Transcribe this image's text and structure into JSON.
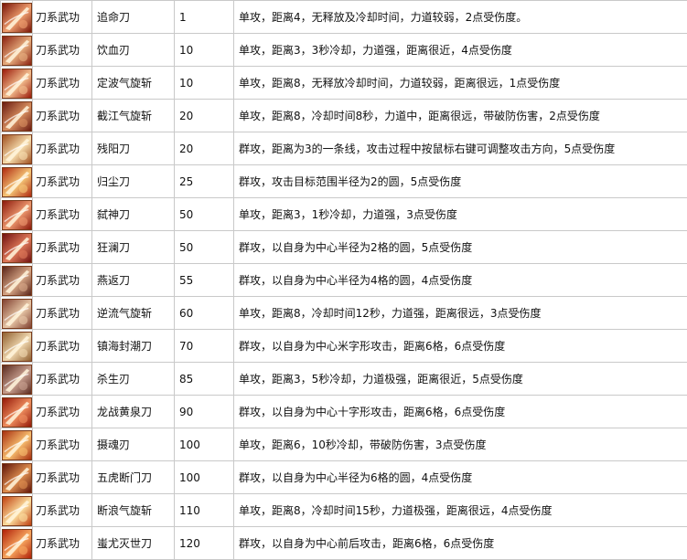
{
  "rows": [
    {
      "icon": "blade-slash-icon",
      "category": "刀系武功",
      "name": "追命刀",
      "level": "1",
      "desc": "单攻，距离4，无释放及冷却时间，力道较弱，2点受伤度。",
      "c1": "#7a1508",
      "c2": "#f0a070"
    },
    {
      "icon": "blade-slash-icon",
      "category": "刀系武功",
      "name": "饮血刃",
      "level": "10",
      "desc": "单攻，距离3，3秒冷却，力道强，距离很近，4点受伤度",
      "c1": "#8a2010",
      "c2": "#e8b080"
    },
    {
      "icon": "blade-slash-icon",
      "category": "刀系武功",
      "name": "定波气旋斩",
      "level": "10",
      "desc": "单攻，距离8，无释放冷却时间，力道较弱，距离很远，1点受伤度",
      "c1": "#9a1a0a",
      "c2": "#f4c090"
    },
    {
      "icon": "blade-slash-icon",
      "category": "刀系武功",
      "name": "截江气旋斩",
      "level": "20",
      "desc": "单攻，距离8，冷却时间8秒，力道中，距离很远，带破防伤害，2点受伤度",
      "c1": "#6a1a10",
      "c2": "#d89060"
    },
    {
      "icon": "blade-slash-icon",
      "category": "刀系武功",
      "name": "残阳刀",
      "level": "20",
      "desc": "群攻，距离为3的一条线，攻击过程中按鼠标右键可调整攻击方向，5点受伤度",
      "c1": "#a05020",
      "c2": "#f8e0b0"
    },
    {
      "icon": "blade-slash-icon",
      "category": "刀系武功",
      "name": "归尘刀",
      "level": "25",
      "desc": "群攻，攻击目标范围半径为2的圆，5点受伤度",
      "c1": "#b02a10",
      "c2": "#f6c878"
    },
    {
      "icon": "blade-slash-icon",
      "category": "刀系武功",
      "name": "弑神刀",
      "level": "50",
      "desc": "单攻，距离3，1秒冷却，力道强，3点受伤度",
      "c1": "#8c1a0c",
      "c2": "#ee9a70"
    },
    {
      "icon": "blade-slash-icon",
      "category": "刀系武功",
      "name": "狂澜刀",
      "level": "50",
      "desc": "群攻，以自身为中心半径为2格的圆，5点受伤度",
      "c1": "#701010",
      "c2": "#e07a5a"
    },
    {
      "icon": "blade-slash-icon",
      "category": "刀系武功",
      "name": "燕返刀",
      "level": "55",
      "desc": "群攻，以自身为中心半径为4格的圆，4点受伤度",
      "c1": "#5a2418",
      "c2": "#d8a888"
    },
    {
      "icon": "blade-slash-icon",
      "category": "刀系武功",
      "name": "逆流气旋斩",
      "level": "60",
      "desc": "单攻，距离8，冷却时间12秒，力道强，距离很远，3点受伤度",
      "c1": "#804030",
      "c2": "#e8c8a8"
    },
    {
      "icon": "blade-slash-icon",
      "category": "刀系武功",
      "name": "镇海封潮刀",
      "level": "70",
      "desc": "群攻，以自身为中心米字形攻击，距离6格，6点受伤度",
      "c1": "#906030",
      "c2": "#f0d8b0"
    },
    {
      "icon": "blade-slash-icon",
      "category": "刀系武功",
      "name": "杀生刃",
      "level": "85",
      "desc": "单攻，距离3，5秒冷却，力道极强，距离很近，5点受伤度",
      "c1": "#5a2a20",
      "c2": "#c8a090"
    },
    {
      "icon": "blade-slash-icon",
      "category": "刀系武功",
      "name": "龙战黄泉刀",
      "level": "90",
      "desc": "群攻，以自身为中心十字形攻击，距离6格，6点受伤度",
      "c1": "#941808",
      "c2": "#f09060"
    },
    {
      "icon": "blade-slash-icon",
      "category": "刀系武功",
      "name": "摄魂刃",
      "level": "100",
      "desc": "单攻，距离6，10秒冷却，带破防伤害，3点受伤度",
      "c1": "#a83010",
      "c2": "#f8c070"
    },
    {
      "icon": "blade-slash-icon",
      "category": "刀系武功",
      "name": "五虎断门刀",
      "level": "100",
      "desc": "群攻，以自身为中心半径为6格的圆，4点受伤度",
      "c1": "#601408",
      "c2": "#e09050"
    },
    {
      "icon": "blade-slash-icon",
      "category": "刀系武功",
      "name": "断浪气旋斩",
      "level": "110",
      "desc": "单攻，距离8，冷却时间15秒，力道极强，距离很远，4点受伤度",
      "c1": "#c04010",
      "c2": "#fce0a0"
    },
    {
      "icon": "blade-slash-icon",
      "category": "刀系武功",
      "name": "蚩尤灭世刀",
      "level": "120",
      "desc": "群攻，以自身为中心前后攻击，距离6格，6点受伤度",
      "c1": "#b02008",
      "c2": "#f8a860"
    }
  ]
}
